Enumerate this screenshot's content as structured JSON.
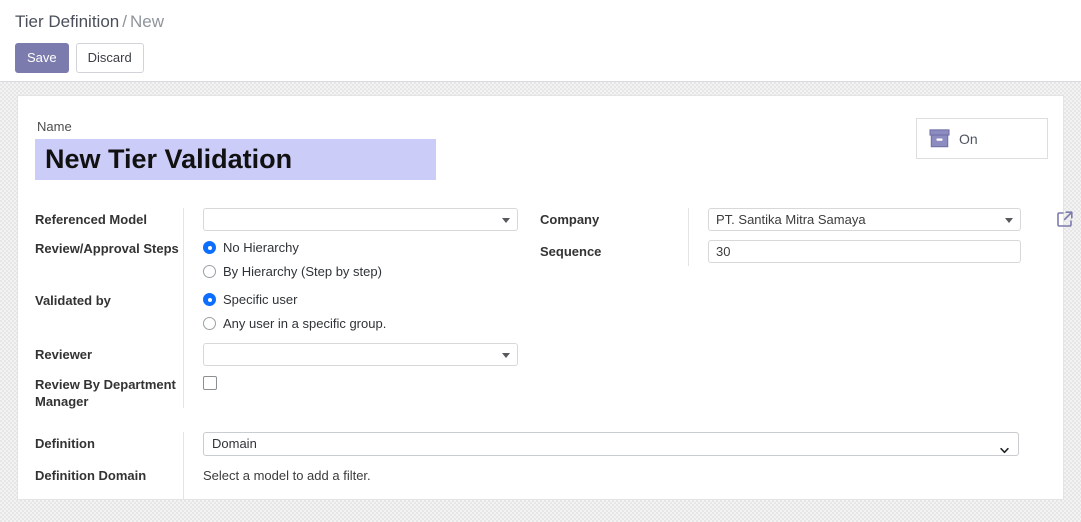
{
  "breadcrumb": {
    "parent": "Tier Definition",
    "separator": "/",
    "current": "New"
  },
  "toolbar": {
    "save_label": "Save",
    "discard_label": "Discard"
  },
  "sheet": {
    "name": {
      "label": "Name",
      "value": "New Tier Validation"
    },
    "stat_button": {
      "icon": "archive-box-icon",
      "label": "On"
    },
    "left_group": {
      "referenced_model": {
        "label": "Referenced Model",
        "value": "",
        "icon": "caret-down-icon"
      },
      "review_steps": {
        "label": "Review/Approval Steps",
        "options": [
          {
            "label": "No Hierarchy",
            "selected": true
          },
          {
            "label": "By Hierarchy (Step by step)",
            "selected": false
          }
        ]
      },
      "validated_by": {
        "label": "Validated by",
        "options": [
          {
            "label": "Specific user",
            "selected": true
          },
          {
            "label": "Any user in a specific group.",
            "selected": false
          }
        ]
      },
      "reviewer": {
        "label": "Reviewer",
        "value": "",
        "icon": "caret-down-icon"
      },
      "review_by_department_manager": {
        "label": "Review By Department Manager",
        "checked": false
      }
    },
    "right_group": {
      "company": {
        "label": "Company",
        "value": "PT. Santika Mitra Samaya",
        "icon": "caret-down-icon",
        "external_link_icon": "external-link-icon"
      },
      "sequence": {
        "label": "Sequence",
        "value": "30"
      }
    },
    "bottom_group": {
      "definition": {
        "label": "Definition",
        "value": "Domain",
        "icon": "chevron-down-icon"
      },
      "definition_domain": {
        "label": "Definition Domain",
        "value": "Select a model to add a filter."
      }
    }
  },
  "colors": {
    "primary": "#7c7bad",
    "selection_highlight": "#ccccf9",
    "radio_accent": "#0d6efd",
    "breadcrumb_parent": "#4a4f59",
    "breadcrumb_muted": "#8f949b"
  }
}
